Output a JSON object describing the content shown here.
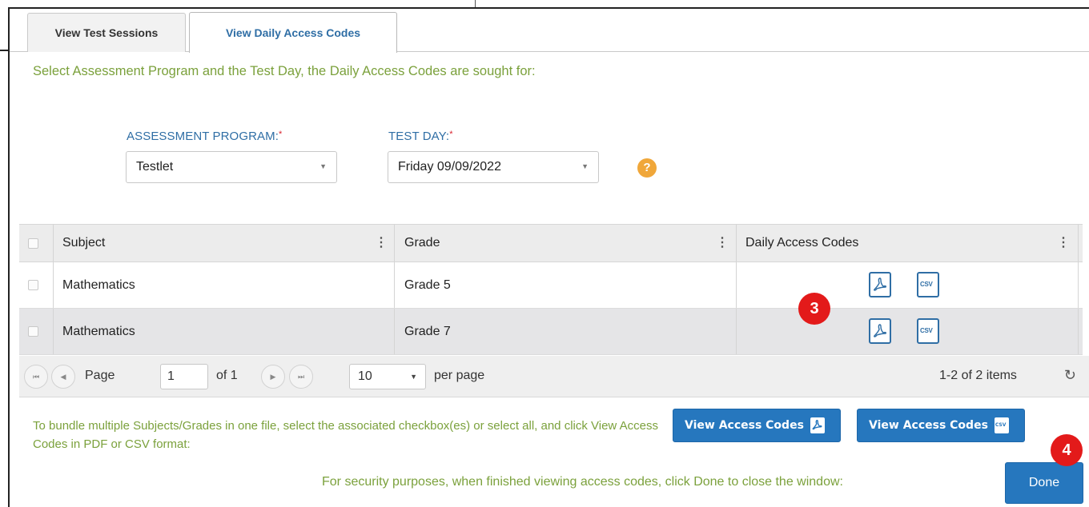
{
  "tabs": [
    {
      "label": "View Test Sessions",
      "active": false
    },
    {
      "label": "View Daily Access Codes",
      "active": true
    }
  ],
  "instruction": "Select Assessment Program and the Test Day, the Daily Access Codes are sought for:",
  "assessment_program": {
    "label": "ASSESSMENT PROGRAM:",
    "required_mark": "*",
    "value": "Testlet"
  },
  "test_day": {
    "label": "TEST DAY:",
    "required_mark": "*",
    "value": "Friday 09/09/2022"
  },
  "help_icon": "?",
  "grid": {
    "columns": [
      "Subject",
      "Grade",
      "Daily Access Codes"
    ],
    "rows": [
      {
        "subject": "Mathematics",
        "grade": "Grade 5"
      },
      {
        "subject": "Mathematics",
        "grade": "Grade 7"
      }
    ]
  },
  "file_icons": {
    "pdf": "pdf-icon",
    "csv": "CSV"
  },
  "pager": {
    "page_label": "Page",
    "page_value": "1",
    "of_label": "of 1",
    "page_size": "10",
    "per_page_label": "per page",
    "items_info": "1-2 of 2 items"
  },
  "bundle_text": "To bundle multiple Subjects/Grades in one file, select the associated checkbox(es) or select all, and click View Access Codes in PDF or CSV format:",
  "buttons": {
    "view_pdf": "View Access Codes",
    "view_csv": "View Access Codes",
    "done": "Done"
  },
  "security_text": "For security purposes, when finished viewing access codes, click Done to close the window:",
  "badges": {
    "step3": "3",
    "step4": "4"
  },
  "colors": {
    "accent": "#2677be",
    "instruction_green": "#7ba13c",
    "badge_red": "#e31a1a",
    "label_blue": "#2f6ea5"
  }
}
